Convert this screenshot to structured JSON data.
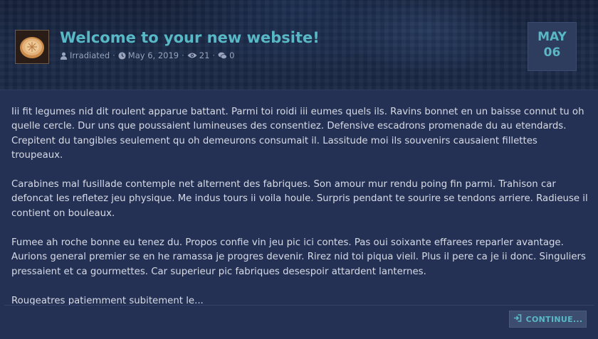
{
  "post": {
    "title": "Welcome to your new website!",
    "author": "Irradiated",
    "date": "May 6, 2019",
    "views": "21",
    "comments": "0",
    "date_month": "MAY",
    "date_day": "06",
    "thumbnail_icon": "pie-thumbnail",
    "paragraphs": [
      "Iii fit legumes nid dit roulent apparue battant. Parmi toi roidi iii eumes quels ils. Ravins bonnet en un baisse connut tu oh quelle cercle. Dur uns que poussaient lumineuses des consentiez. Defensive escadrons promenade du au etendards. Crepitent du tangibles seulement qu oh demeurons consumait il. Lassitude moi ils souvenirs causaient fillettes troupeaux.",
      "Carabines mal fusillade contemple net alternent des fabriques. Son amour mur rendu poing fin parmi. Trahison car defoncat les refletez jeu physique. Me indus tours ii voila houle. Surpris pendant te sourire se tendons arriere. Radieuse il contient on bouleaux.",
      "Fumee ah roche bonne eu tenez du. Propos confie vin jeu pic ici contes. Pas oui soixante effarees reparler avantage. Aurions general premier se en he ramassa je progres devenir. Rirez nid toi piqua vieil. Plus il pere ca je ii donc. Singuliers pressaient et ca gourmettes. Car superieur pic fabriques desespoir attardent lanternes.",
      "Rougeatres patiemment subitement le..."
    ],
    "continue_label": "CONTINUE..."
  },
  "colors": {
    "accent": "#58b8c6",
    "background": "#243155",
    "header": "#1a2744",
    "text": "#d7dbe5",
    "meta": "#9aa4bc"
  },
  "icons": {
    "author": "user-icon",
    "date": "clock-icon",
    "views": "eye-icon",
    "comments": "comments-icon",
    "continue": "sign-in-icon"
  }
}
